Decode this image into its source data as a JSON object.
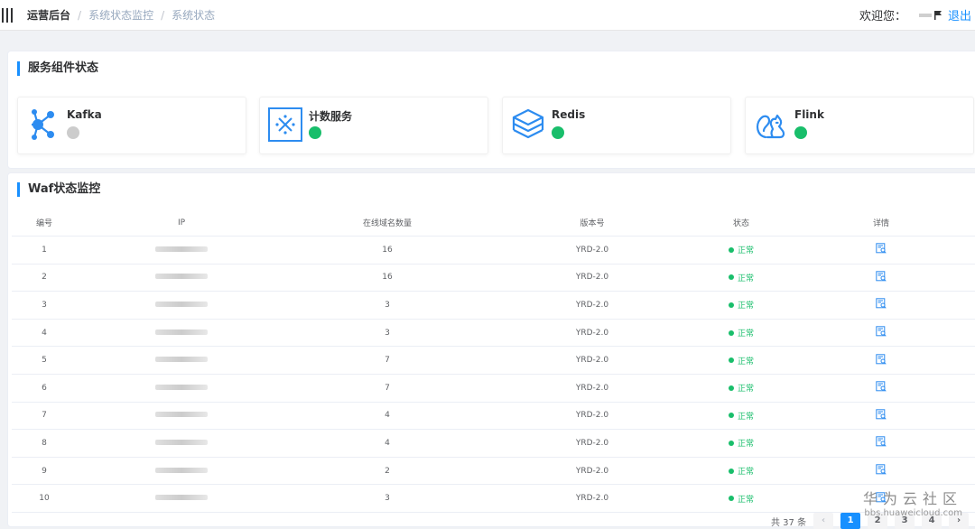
{
  "breadcrumb": {
    "root": "运营后台",
    "level2": "系统状态监控",
    "current": "系统状态",
    "separator": "/"
  },
  "user": {
    "welcome": "欢迎您：",
    "logout": "退出"
  },
  "services": {
    "title": "服务组件状态",
    "items": [
      {
        "name": "Kafka",
        "status_color": "#cccccc",
        "icon": "kafka-icon"
      },
      {
        "name": "计数服务",
        "status_color": "#19be6b",
        "icon": "counter-icon"
      },
      {
        "name": "Redis",
        "status_color": "#19be6b",
        "icon": "redis-icon"
      },
      {
        "name": "Flink",
        "status_color": "#19be6b",
        "icon": "flink-squirrel-icon"
      }
    ]
  },
  "waf": {
    "title": "Waf状态监控",
    "columns": {
      "no": "编号",
      "ip": "IP",
      "count": "在线域名数量",
      "version": "版本号",
      "status": "状态",
      "detail": "详情"
    },
    "rows": [
      {
        "no": "1",
        "count": "16",
        "version": "YRD-2.0",
        "status": "正常"
      },
      {
        "no": "2",
        "count": "16",
        "version": "YRD-2.0",
        "status": "正常"
      },
      {
        "no": "3",
        "count": "3",
        "version": "YRD-2.0",
        "status": "正常"
      },
      {
        "no": "4",
        "count": "3",
        "version": "YRD-2.0",
        "status": "正常"
      },
      {
        "no": "5",
        "count": "7",
        "version": "YRD-2.0",
        "status": "正常"
      },
      {
        "no": "6",
        "count": "7",
        "version": "YRD-2.0",
        "status": "正常"
      },
      {
        "no": "7",
        "count": "4",
        "version": "YRD-2.0",
        "status": "正常"
      },
      {
        "no": "8",
        "count": "4",
        "version": "YRD-2.0",
        "status": "正常"
      },
      {
        "no": "9",
        "count": "2",
        "version": "YRD-2.0",
        "status": "正常"
      },
      {
        "no": "10",
        "count": "3",
        "version": "YRD-2.0",
        "status": "正常"
      }
    ],
    "pagination": {
      "total": "共 37 条",
      "prev": "‹",
      "pages": [
        "1",
        "2",
        "3",
        "4"
      ],
      "active": "1",
      "next": "›"
    }
  },
  "watermark": {
    "cn": "华为云社区",
    "en": "bbs.huaweicloud.com"
  },
  "colors": {
    "accent": "#1890ff",
    "ok": "#19be6b",
    "offline": "#cccccc"
  }
}
